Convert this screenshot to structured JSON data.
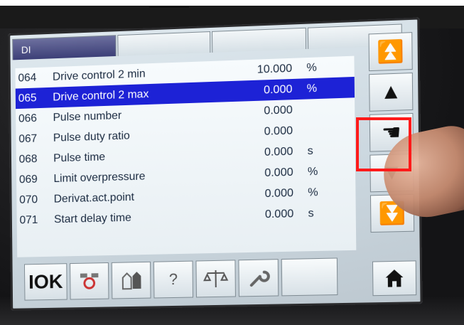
{
  "tabs": [
    {
      "label": "DI",
      "active": true
    },
    {
      "label": ""
    },
    {
      "label": ""
    },
    {
      "label": ""
    }
  ],
  "rows": [
    {
      "num": "064",
      "name": "Drive control 2 min",
      "value": "10.000",
      "unit": "%"
    },
    {
      "num": "065",
      "name": "Drive control 2 max",
      "value": "0.000",
      "unit": "%",
      "selected": true
    },
    {
      "num": "066",
      "name": "Pulse number",
      "value": "0.000",
      "unit": ""
    },
    {
      "num": "067",
      "name": "Pulse duty ratio",
      "value": "0.000",
      "unit": ""
    },
    {
      "num": "068",
      "name": "Pulse time",
      "value": "0.000",
      "unit": "s"
    },
    {
      "num": "069",
      "name": "Limit overpressure",
      "value": "0.000",
      "unit": "%"
    },
    {
      "num": "070",
      "name": "Derivat.act.point",
      "value": "0.000",
      "unit": "%"
    },
    {
      "num": "071",
      "name": "Start delay time",
      "value": "0.000",
      "unit": "s"
    }
  ],
  "side_buttons": [
    {
      "name": "scroll-top-button",
      "icon": "scroll-top-icon",
      "glyph": "⏫"
    },
    {
      "name": "scroll-up-button",
      "icon": "arrow-up-icon",
      "glyph": "▲"
    },
    {
      "name": "edit-button",
      "icon": "hand-pointer-icon",
      "glyph": "☚"
    },
    {
      "name": "scroll-down-button",
      "icon": "arrow-down-icon",
      "glyph": "▼"
    },
    {
      "name": "scroll-bottom-button",
      "icon": "scroll-bottom-icon",
      "glyph": "⏬"
    }
  ],
  "bottom_buttons": [
    {
      "name": "io-button",
      "icon": "io-icon",
      "label": "IOK"
    },
    {
      "name": "diagnostics-button",
      "icon": "diagnostics-icon",
      "label": ""
    },
    {
      "name": "valve-button",
      "icon": "valve-icon",
      "label": ""
    },
    {
      "name": "help-button",
      "icon": "help-icon",
      "label": "?"
    },
    {
      "name": "balance-button",
      "icon": "balance-icon",
      "label": ""
    },
    {
      "name": "tools-button",
      "icon": "wrench-icon",
      "label": ""
    },
    {
      "name": "empty-button",
      "icon": "",
      "label": ""
    }
  ],
  "home_button": {
    "icon": "home-icon"
  },
  "colors": {
    "selection": "#1d22d6",
    "highlight": "#ff1a1a",
    "tab_active": "#3c3f77"
  }
}
